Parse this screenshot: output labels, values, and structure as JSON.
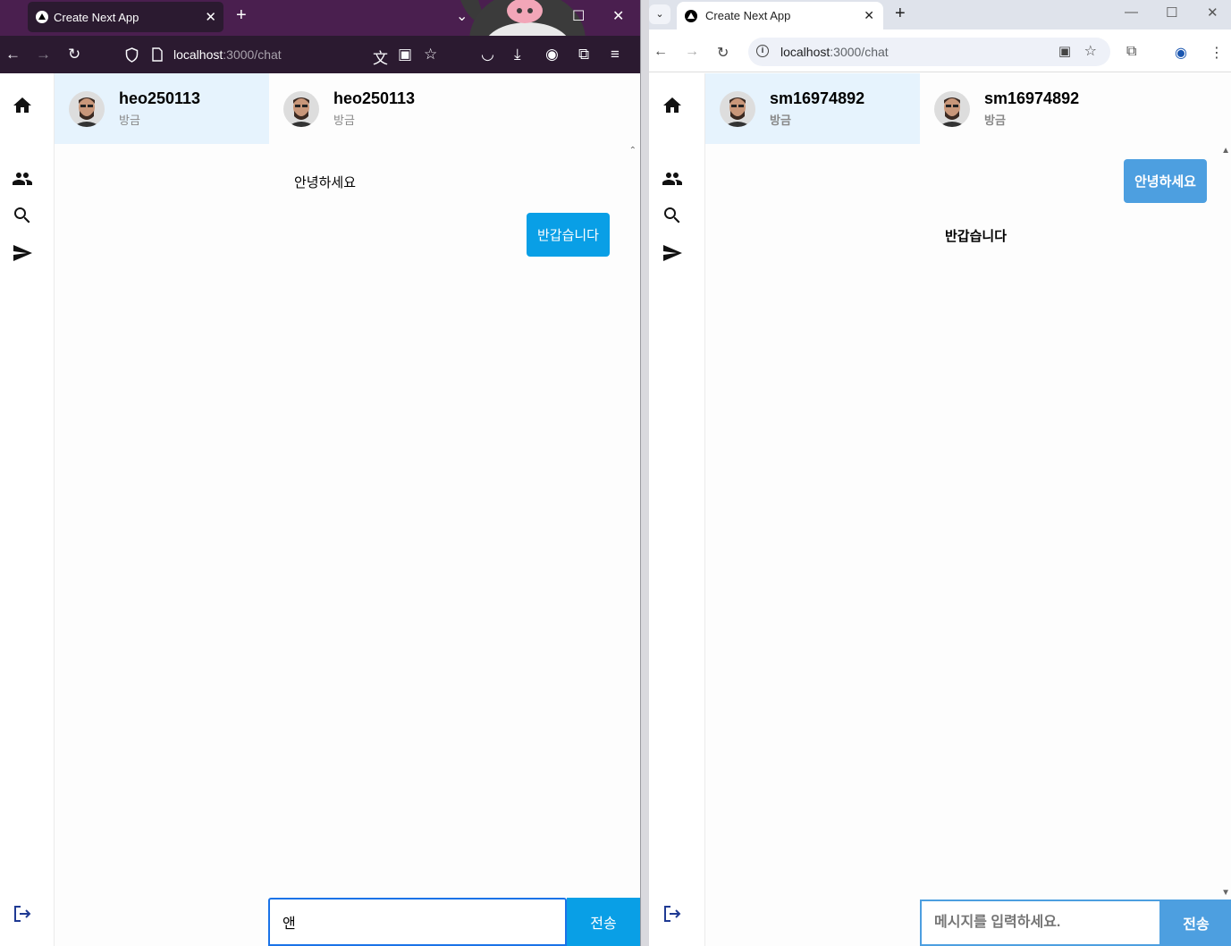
{
  "left_browser": {
    "tab_title": "Create Next App",
    "url_host": "localhost",
    "url_path": ":3000/chat",
    "app": {
      "conversations": [
        {
          "name": "heo250113",
          "time": "방금",
          "active": true
        },
        {
          "name": "heo250113",
          "time": "방금",
          "active": false
        }
      ],
      "messages": [
        {
          "text": "안녕하세요",
          "direction": "in"
        },
        {
          "text": "반갑습니다",
          "direction": "out"
        }
      ],
      "input_value": "앤",
      "send_label": "전송"
    }
  },
  "right_browser": {
    "tab_title": "Create Next App",
    "url_host": "localhost",
    "url_path": ":3000/chat",
    "app": {
      "conversations": [
        {
          "name": "sm16974892",
          "time": "방금",
          "active": true
        },
        {
          "name": "sm16974892",
          "time": "방금",
          "active": false
        }
      ],
      "messages": [
        {
          "text": "안녕하세요",
          "direction": "out"
        },
        {
          "text": "반갑습니다",
          "direction": "in"
        }
      ],
      "input_placeholder": "메시지를 입력하세요.",
      "send_label": "전송"
    }
  },
  "colors": {
    "firefox_tabbar": "#4a1f4f",
    "firefox_toolbar": "#2b1a30",
    "active_conversation_bg": "#e6f3fd",
    "bubble_left": "#099fe6",
    "bubble_right": "#4d9fe0"
  },
  "icons": {
    "sidebar": [
      "home-icon",
      "people-icon",
      "search-icon",
      "send-icon",
      "logout-icon"
    ]
  }
}
